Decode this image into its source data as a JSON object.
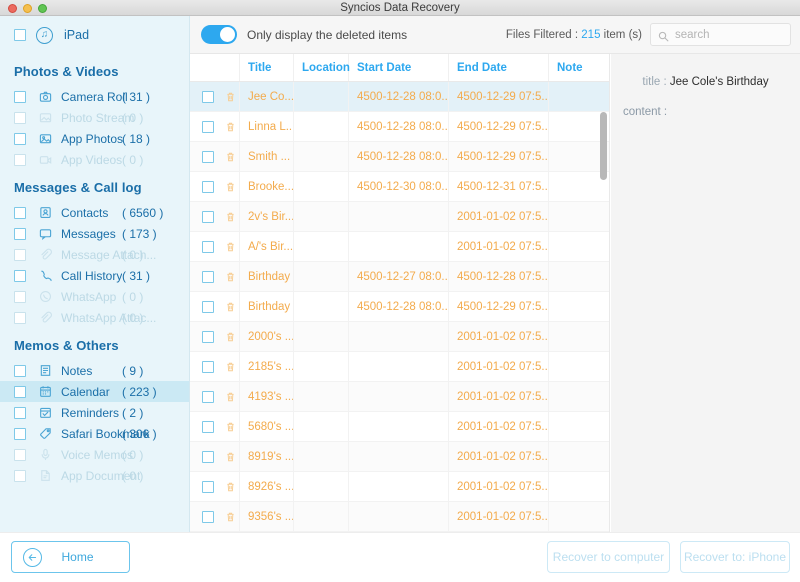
{
  "window": {
    "title": "Syncios Data Recovery",
    "traffic_lights": [
      "close-button",
      "minimize-button",
      "zoom-button"
    ]
  },
  "sidebar": {
    "device": {
      "label": "iPad",
      "icon": "device-music-icon"
    },
    "groups": [
      {
        "title": "Photos & Videos",
        "items": [
          {
            "label": "Camera Roll",
            "count": "( 31 )",
            "icon": "camera-icon",
            "disabled": false,
            "selected": false
          },
          {
            "label": "Photo Stream",
            "count": "( 0 )",
            "icon": "photo-icon",
            "disabled": true,
            "selected": false
          },
          {
            "label": "App Photos",
            "count": "( 18 )",
            "icon": "image-icon",
            "disabled": false,
            "selected": false
          },
          {
            "label": "App Videos",
            "count": "( 0 )",
            "icon": "video-icon",
            "disabled": true,
            "selected": false
          }
        ]
      },
      {
        "title": "Messages & Call log",
        "items": [
          {
            "label": "Contacts",
            "count": "( 6560 )",
            "icon": "contact-icon",
            "disabled": false,
            "selected": false
          },
          {
            "label": "Messages",
            "count": "( 173 )",
            "icon": "message-icon",
            "disabled": false,
            "selected": false
          },
          {
            "label": "Message Attach...",
            "count": "( 0 )",
            "icon": "paperclip-icon",
            "disabled": true,
            "selected": false
          },
          {
            "label": "Call History",
            "count": "( 31 )",
            "icon": "phone-icon",
            "disabled": false,
            "selected": false
          },
          {
            "label": "WhatsApp",
            "count": "( 0 )",
            "icon": "whatsapp-icon",
            "disabled": true,
            "selected": false
          },
          {
            "label": "WhatsApp Attac...",
            "count": "( 0 )",
            "icon": "paperclip-icon",
            "disabled": true,
            "selected": false
          }
        ]
      },
      {
        "title": "Memos & Others",
        "items": [
          {
            "label": "Notes",
            "count": "( 9 )",
            "icon": "note-icon",
            "disabled": false,
            "selected": false
          },
          {
            "label": "Calendar",
            "count": "( 223 )",
            "icon": "calendar-icon",
            "disabled": false,
            "selected": true
          },
          {
            "label": "Reminders",
            "count": "( 2 )",
            "icon": "reminder-icon",
            "disabled": false,
            "selected": false
          },
          {
            "label": "Safari Bookmark",
            "count": "( 306 )",
            "icon": "bookmark-icon",
            "disabled": false,
            "selected": false
          },
          {
            "label": "Voice Memos",
            "count": "( 0 )",
            "icon": "microphone-icon",
            "disabled": true,
            "selected": false
          },
          {
            "label": "App Document",
            "count": "( 0 )",
            "icon": "document-icon",
            "disabled": true,
            "selected": false
          }
        ]
      }
    ]
  },
  "toolbar": {
    "toggle_label": "Only display the deleted items",
    "toggle_on": true,
    "filter_prefix": "Files Filtered : ",
    "filter_count": "215",
    "filter_suffix": " item (s)",
    "search_placeholder": "search",
    "search_value": ""
  },
  "table": {
    "columns": [
      "",
      "Title",
      "Location",
      "Start Date",
      "End Date",
      "Note"
    ],
    "rows": [
      {
        "title": "Jee Co...",
        "location": "",
        "start": "4500-12-28 08:0...",
        "end": "4500-12-29 07:5...",
        "note": "",
        "selected": true
      },
      {
        "title": "Linna L...",
        "location": "",
        "start": "4500-12-28 08:0...",
        "end": "4500-12-29 07:5...",
        "note": "",
        "selected": false
      },
      {
        "title": "Smith ...",
        "location": "",
        "start": "4500-12-28 08:0...",
        "end": "4500-12-29 07:5...",
        "note": "",
        "selected": false
      },
      {
        "title": "Brooke...",
        "location": "",
        "start": "4500-12-30 08:0...",
        "end": "4500-12-31 07:5...",
        "note": "",
        "selected": false
      },
      {
        "title": "2v's Bir...",
        "location": "",
        "start": "",
        "end": "2001-01-02 07:5...",
        "note": "",
        "selected": false
      },
      {
        "title": "A/'s Bir...",
        "location": "",
        "start": "",
        "end": "2001-01-02 07:5...",
        "note": "",
        "selected": false
      },
      {
        "title": "Birthday",
        "location": "",
        "start": "4500-12-27 08:0...",
        "end": "4500-12-28 07:5...",
        "note": "",
        "selected": false
      },
      {
        "title": "Birthday",
        "location": "",
        "start": "4500-12-28 08:0...",
        "end": "4500-12-29 07:5...",
        "note": "",
        "selected": false
      },
      {
        "title": "2000's ...",
        "location": "",
        "start": "",
        "end": "2001-01-02 07:5...",
        "note": "",
        "selected": false
      },
      {
        "title": "2185's ...",
        "location": "",
        "start": "",
        "end": "2001-01-02 07:5...",
        "note": "",
        "selected": false
      },
      {
        "title": "4193's ...",
        "location": "",
        "start": "",
        "end": "2001-01-02 07:5...",
        "note": "",
        "selected": false
      },
      {
        "title": "5680's ...",
        "location": "",
        "start": "",
        "end": "2001-01-02 07:5...",
        "note": "",
        "selected": false
      },
      {
        "title": "8919's ...",
        "location": "",
        "start": "",
        "end": "2001-01-02 07:5...",
        "note": "",
        "selected": false
      },
      {
        "title": "8926's ...",
        "location": "",
        "start": "",
        "end": "2001-01-02 07:5...",
        "note": "",
        "selected": false
      },
      {
        "title": "9356's ...",
        "location": "",
        "start": "",
        "end": "2001-01-02 07:5...",
        "note": "",
        "selected": false
      }
    ]
  },
  "detail": {
    "title_label": "title : ",
    "title_value": "Jee Cole's Birthday",
    "content_label": "content :",
    "content_value": ""
  },
  "footer": {
    "home_label": "Home",
    "recover_computer_label": "Recover to computer",
    "recover_iphone_label": "Recover to: iPhone"
  },
  "colors": {
    "accent_blue": "#2da8ef",
    "sidebar_bg": "#e8f5fa",
    "row_text_orange": "#f3ab4c",
    "selected_row": "#e3f1f8"
  }
}
